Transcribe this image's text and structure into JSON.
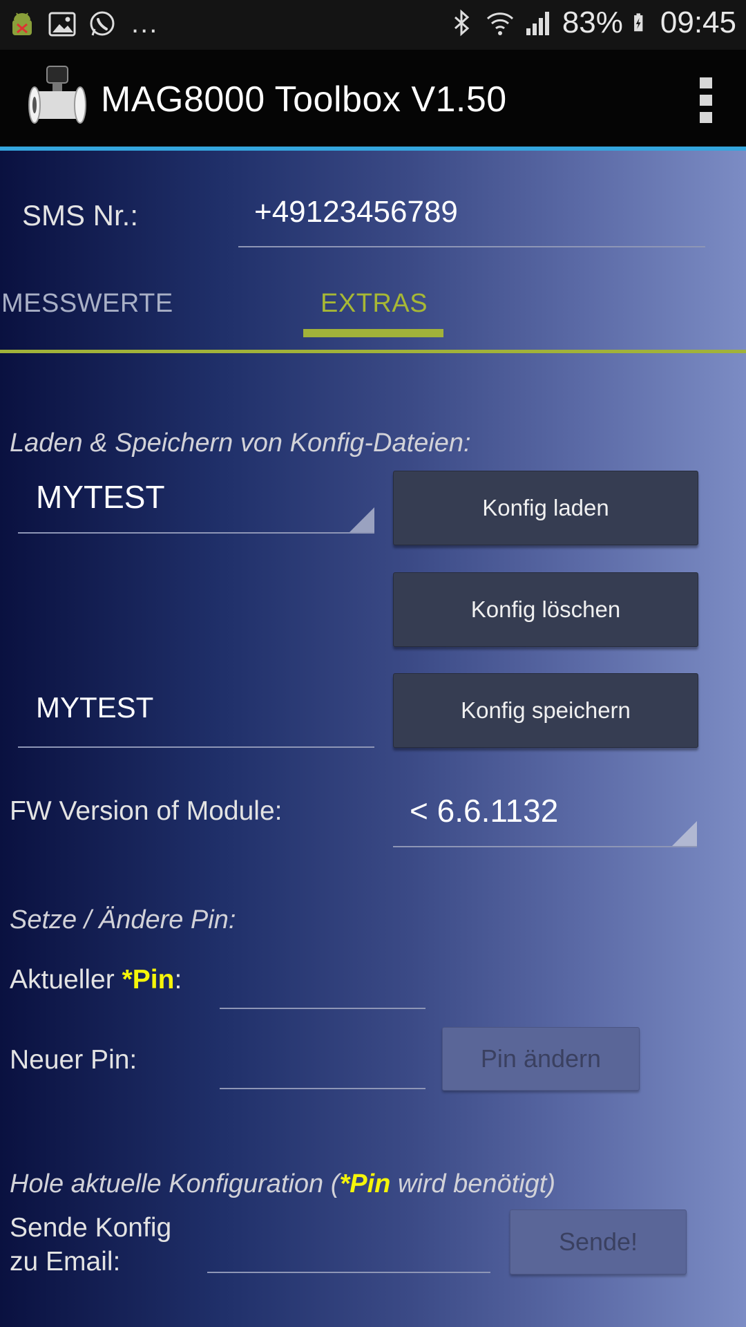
{
  "status_bar": {
    "left_icons": [
      "android-debug-icon",
      "image-icon",
      "whatsapp-icon"
    ],
    "more": "...",
    "battery": "83%",
    "time": "09:45"
  },
  "app_bar": {
    "title": "MAG8000 Toolbox V1.50"
  },
  "sms": {
    "label": "SMS Nr.:",
    "value": "+49123456789"
  },
  "tabs": [
    {
      "label": "MESSWERTE",
      "selected": false
    },
    {
      "label": "EXTRAS",
      "selected": true
    }
  ],
  "config_section": {
    "heading": "Laden & Speichern von Konfig-Dateien:",
    "selected_file": "MYTEST",
    "save_name_value": "MYTEST",
    "load_button": "Konfig laden",
    "delete_button": "Konfig löschen",
    "save_button": "Konfig speichern"
  },
  "fw": {
    "label": "FW Version of Module:",
    "selected": "< 6.6.1132"
  },
  "pin_section": {
    "heading": "Setze / Ändere Pin:",
    "current_label_prefix": "Aktueller ",
    "current_label_pin": "*Pin",
    "current_label_suffix": ":",
    "current_value": "",
    "new_label": "Neuer Pin:",
    "new_value": "",
    "change_button": "Pin ändern"
  },
  "email_section": {
    "heading_prefix": "Hole aktuelle Konfiguration (",
    "heading_pin": "*Pin",
    "heading_suffix": " wird benötigt)",
    "label_line1": "Sende Konfig",
    "label_line2": "zu Email:",
    "email_value": "",
    "send_button": "Sende!"
  },
  "colors": {
    "accent_green": "#a1b23a",
    "appbar_underline": "#35a6de",
    "pin_yellow": "#f5f50a"
  }
}
